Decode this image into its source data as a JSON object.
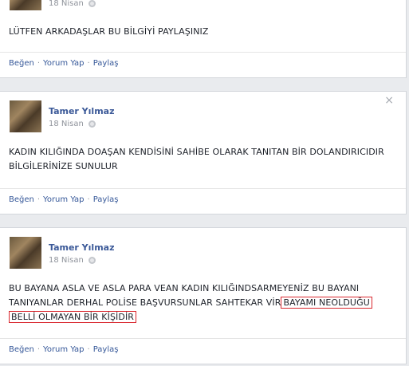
{
  "posts": [
    {
      "date": "18 Nisan",
      "text": "LÜTFEN ARKADAŞLAR BU BİLGİYİ PAYLAŞINIZ",
      "actions": {
        "like": "Beğen",
        "comment": "Yorum Yap",
        "share": "Paylaş"
      }
    },
    {
      "author": "Tamer Yılmaz",
      "date": "18 Nisan",
      "text_line1": "KADIN KILIĞINDA DOAŞAN KENDİSİNİ SAHİBE OLARAK TANITAN BİR DOLANDIRICIDIR",
      "text_line2": "BİLGİLERİNİZE SUNULUR",
      "close": "×",
      "actions": {
        "like": "Beğen",
        "comment": "Yorum Yap",
        "share": "Paylaş"
      }
    },
    {
      "author": "Tamer Yılmaz",
      "date": "18 Nisan",
      "text_line1": "BU BAYANA ASLA VE ASLA PARA VEAN KADIN KILIĞINDSARMEYENİZ BU BAYANI",
      "text_line2_a": "TANIYANLAR DERHAL POLİSE BAŞVURSUNLAR SAHTEKAR Vİ",
      "text_line2_b": "R",
      "text_line2_hl": "BAYAMI NEOLDUĞU",
      "text_line3_hl": "BELLİ OLMAYAN BİR KİŞİDİR",
      "actions": {
        "like": "Beğen",
        "comment": "Yorum Yap",
        "share": "Paylaş"
      }
    }
  ],
  "separator": "·"
}
